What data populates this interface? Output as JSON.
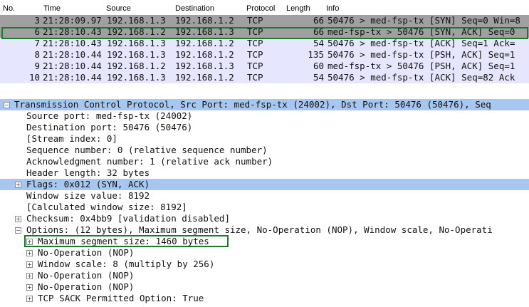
{
  "columns": {
    "no": "No.",
    "time": "Time",
    "source": "Source",
    "destination": "Destination",
    "protocol": "Protocol",
    "length": "Length",
    "info": "Info"
  },
  "packets": [
    {
      "no": "3",
      "time": "21:28:09.97",
      "source": "192.168.1.3",
      "destination": "192.168.1.2",
      "protocol": "TCP",
      "length": "66",
      "info": "50476 > med-fsp-tx [SYN] Seq=0 Win=8"
    },
    {
      "no": "6",
      "time": "21:28:10.43",
      "source": "192.168.1.2",
      "destination": "192.168.1.3",
      "protocol": "TCP",
      "length": "66",
      "info": "med-fsp-tx > 50476 [SYN, ACK] Seq=0"
    },
    {
      "no": "7",
      "time": "21:28:10.43",
      "source": "192.168.1.3",
      "destination": "192.168.1.2",
      "protocol": "TCP",
      "length": "54",
      "info": "50476 > med-fsp-tx [ACK] Seq=1 Ack="
    },
    {
      "no": "8",
      "time": "21:28:10.44",
      "source": "192.168.1.3",
      "destination": "192.168.1.2",
      "protocol": "TCP",
      "length": "135",
      "info": "50476 > med-fsp-tx [PSH, ACK] Seq=1"
    },
    {
      "no": "9",
      "time": "21:28:10.44",
      "source": "192.168.1.2",
      "destination": "192.168.1.3",
      "protocol": "TCP",
      "length": "60",
      "info": "med-fsp-tx > 50476 [PSH, ACK] Seq=1"
    },
    {
      "no": "10",
      "time": "21:28:10.44",
      "source": "192.168.1.3",
      "destination": "192.168.1.2",
      "protocol": "TCP",
      "length": "54",
      "info": "50476 > med-fsp-tx [ACK] Seq=82 Ack"
    }
  ],
  "details": {
    "tcp_header": "Transmission Control Protocol, Src Port: med-fsp-tx (24002), Dst Port: 50476 (50476), Seq",
    "source_port": "Source port: med-fsp-tx (24002)",
    "destination_port": "Destination port: 50476 (50476)",
    "stream_index": "[Stream index: 0]",
    "sequence_number": "Sequence number: 0    (relative sequence number)",
    "ack_number": "Acknowledgment number: 1    (relative ack number)",
    "header_length": "Header length: 32 bytes",
    "flags": "Flags: 0x012 (SYN, ACK)",
    "window_size": "Window size value: 8192",
    "calc_window": "[Calculated window size: 8192]",
    "checksum": "Checksum: 0x4bb9 [validation disabled]",
    "options": "Options: (12 bytes), Maximum segment size, No-Operation (NOP), Window scale, No-Operati",
    "opt_mss": "Maximum segment size: 1460 bytes",
    "opt_nop1": "No-Operation (NOP)",
    "opt_wscale": "Window scale: 8 (multiply by 256)",
    "opt_nop2": "No-Operation (NOP)",
    "opt_nop3": "No-Operation (NOP)",
    "opt_sack": "TCP SACK Permitted Option: True"
  },
  "toggles": {
    "expand": "+",
    "collapse": "−"
  },
  "colors": {
    "selection_outline": "#1a7a2a",
    "tcp_row": "#e7e6ff",
    "header_highlight": "#a7c7f0"
  }
}
